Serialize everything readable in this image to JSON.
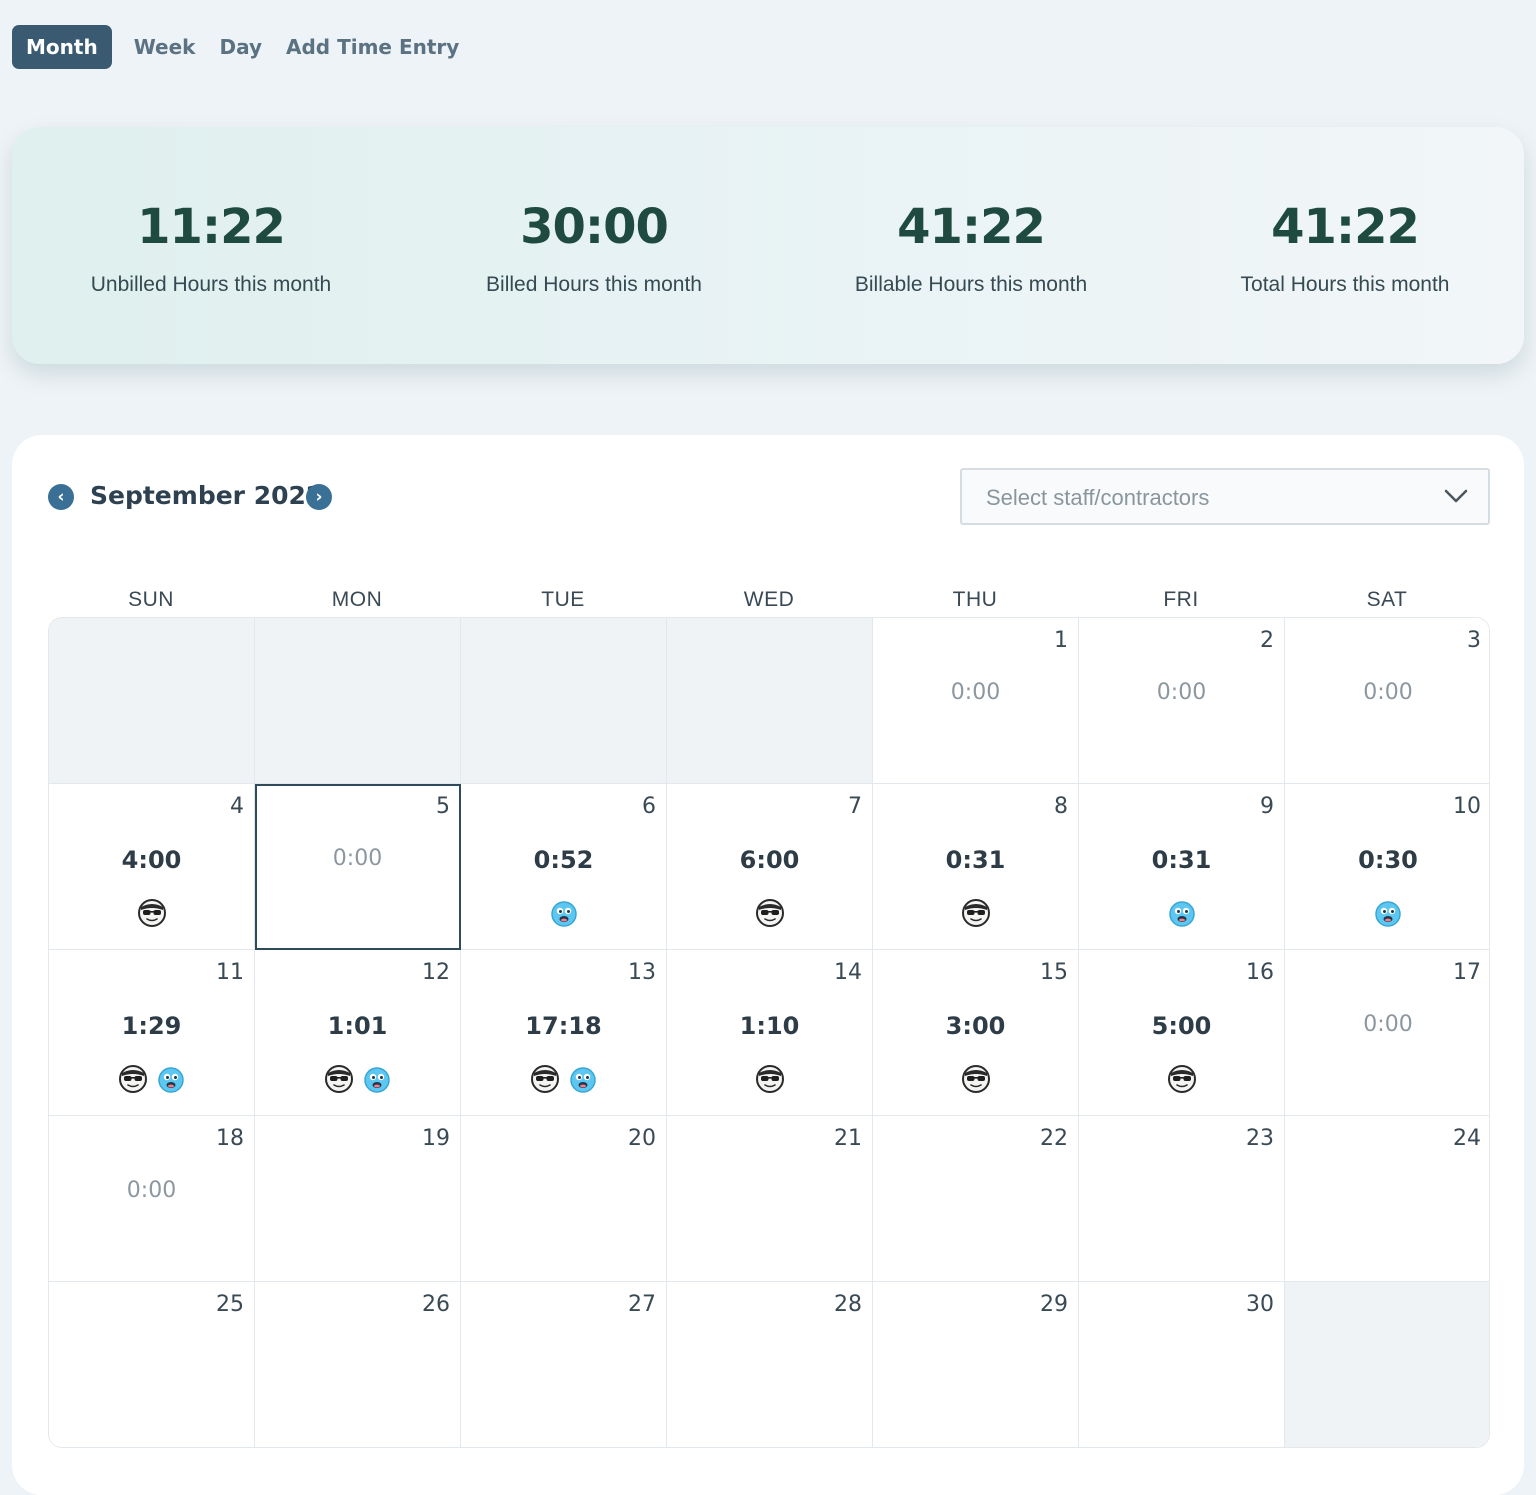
{
  "tabs": [
    {
      "label": "Month",
      "active": true
    },
    {
      "label": "Week"
    },
    {
      "label": "Day"
    },
    {
      "label": "Add Time Entry"
    }
  ],
  "summary": [
    {
      "value": "11:22",
      "label": "Unbilled Hours this month"
    },
    {
      "value": "30:00",
      "label": "Billed Hours this month"
    },
    {
      "value": "41:22",
      "label": "Billable Hours this month"
    },
    {
      "value": "41:22",
      "label": "Total Hours this month"
    }
  ],
  "calendar": {
    "title": "September 2022",
    "prev_icon": "chevron-left-icon",
    "next_icon": "chevron-right-icon",
    "staff_select": {
      "placeholder": "Select staff/contractors"
    },
    "weekdays": [
      "SUN",
      "MON",
      "TUE",
      "WED",
      "THU",
      "FRI",
      "SAT"
    ],
    "today": "5",
    "avatar_colors": {
      "sunglasses": "#2a2a2a",
      "blue": "#5cc7f0"
    },
    "weeks": [
      [
        {
          "empty": true
        },
        {
          "empty": true
        },
        {
          "empty": true
        },
        {
          "empty": true
        },
        {
          "day": "1",
          "hours": "0:00",
          "avatars": []
        },
        {
          "day": "2",
          "hours": "0:00",
          "avatars": []
        },
        {
          "day": "3",
          "hours": "0:00",
          "avatars": []
        }
      ],
      [
        {
          "day": "4",
          "hours": "4:00",
          "avatars": [
            "sunglasses"
          ]
        },
        {
          "day": "5",
          "hours": "0:00",
          "avatars": []
        },
        {
          "day": "6",
          "hours": "0:52",
          "avatars": [
            "blue"
          ]
        },
        {
          "day": "7",
          "hours": "6:00",
          "avatars": [
            "sunglasses"
          ]
        },
        {
          "day": "8",
          "hours": "0:31",
          "avatars": [
            "sunglasses"
          ]
        },
        {
          "day": "9",
          "hours": "0:31",
          "avatars": [
            "blue"
          ]
        },
        {
          "day": "10",
          "hours": "0:30",
          "avatars": [
            "blue"
          ]
        }
      ],
      [
        {
          "day": "11",
          "hours": "1:29",
          "avatars": [
            "sunglasses",
            "blue"
          ]
        },
        {
          "day": "12",
          "hours": "1:01",
          "avatars": [
            "sunglasses",
            "blue"
          ]
        },
        {
          "day": "13",
          "hours": "17:18",
          "avatars": [
            "sunglasses",
            "blue"
          ]
        },
        {
          "day": "14",
          "hours": "1:10",
          "avatars": [
            "sunglasses"
          ]
        },
        {
          "day": "15",
          "hours": "3:00",
          "avatars": [
            "sunglasses"
          ]
        },
        {
          "day": "16",
          "hours": "5:00",
          "avatars": [
            "sunglasses"
          ]
        },
        {
          "day": "17",
          "hours": "0:00",
          "avatars": []
        }
      ],
      [
        {
          "day": "18",
          "hours": "0:00",
          "avatars": []
        },
        {
          "day": "19"
        },
        {
          "day": "20"
        },
        {
          "day": "21"
        },
        {
          "day": "22"
        },
        {
          "day": "23"
        },
        {
          "day": "24"
        }
      ],
      [
        {
          "day": "25"
        },
        {
          "day": "26"
        },
        {
          "day": "27"
        },
        {
          "day": "28"
        },
        {
          "day": "29"
        },
        {
          "day": "30"
        },
        {
          "empty": true
        }
      ]
    ]
  }
}
